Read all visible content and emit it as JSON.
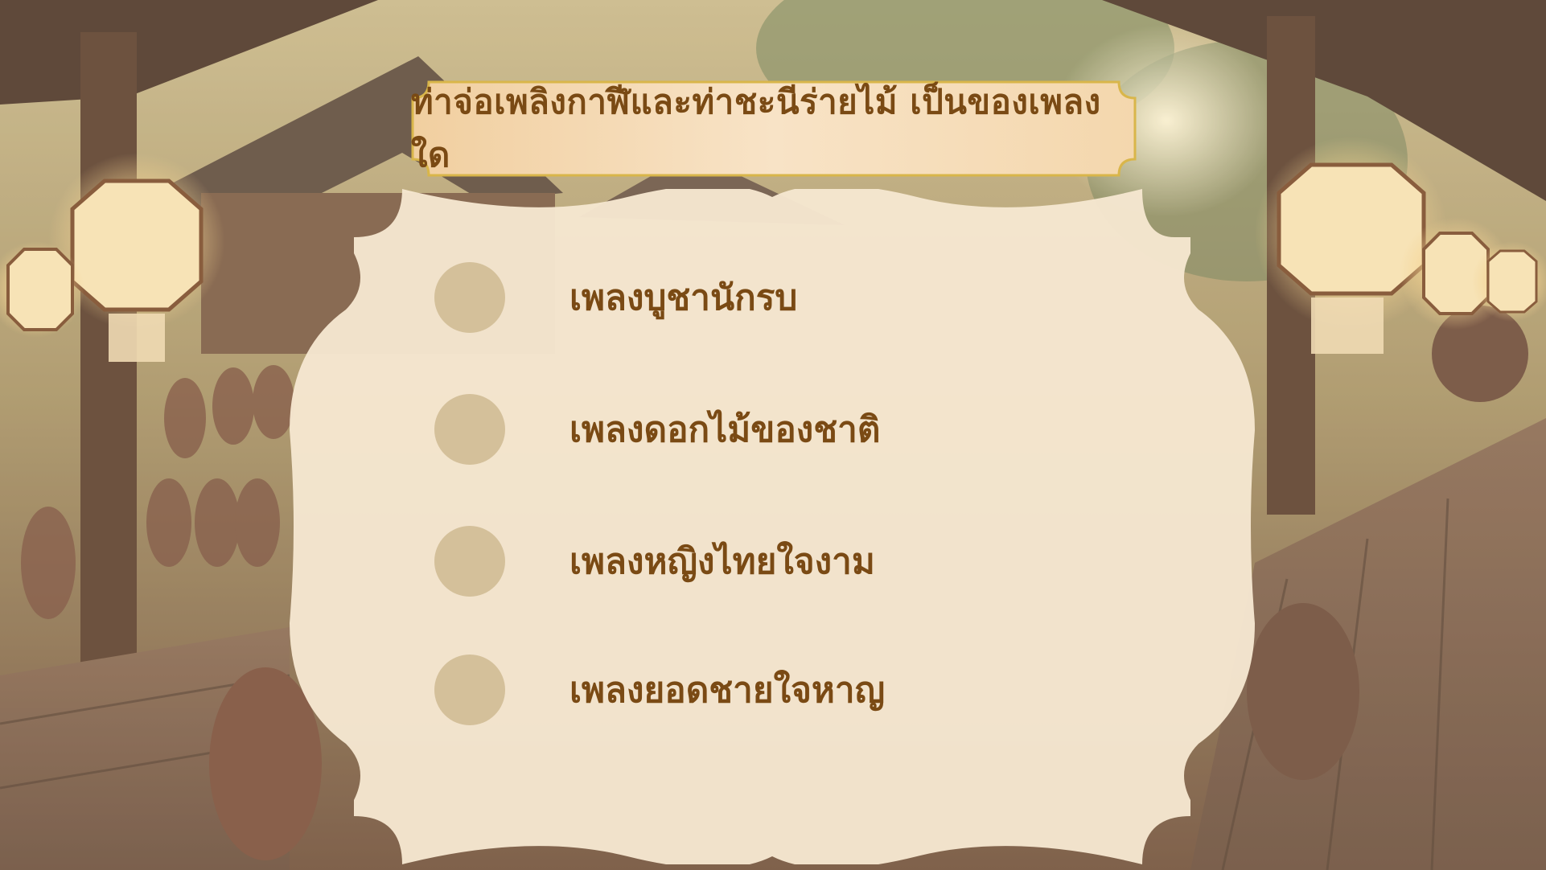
{
  "question": "ท่าจ่อเพลิงกาฬีและท่าชะนีร่ายไม้ เป็นของเพลงใด",
  "options": [
    {
      "label": "เพลงบูชานักรบ"
    },
    {
      "label": "เพลงดอกไม้ของชาติ"
    },
    {
      "label": "เพลงหญิงไทยใจงาม"
    },
    {
      "label": "เพลงยอดชายใจหาญ"
    }
  ],
  "colors": {
    "accent_text": "#7a4a14",
    "card": "#f5e6cf",
    "banner_border": "#d9b64a",
    "marker": "#d4c09a"
  },
  "background": {
    "scene": "northern-thai-village-pavilion-with-hanging-lanterns"
  }
}
